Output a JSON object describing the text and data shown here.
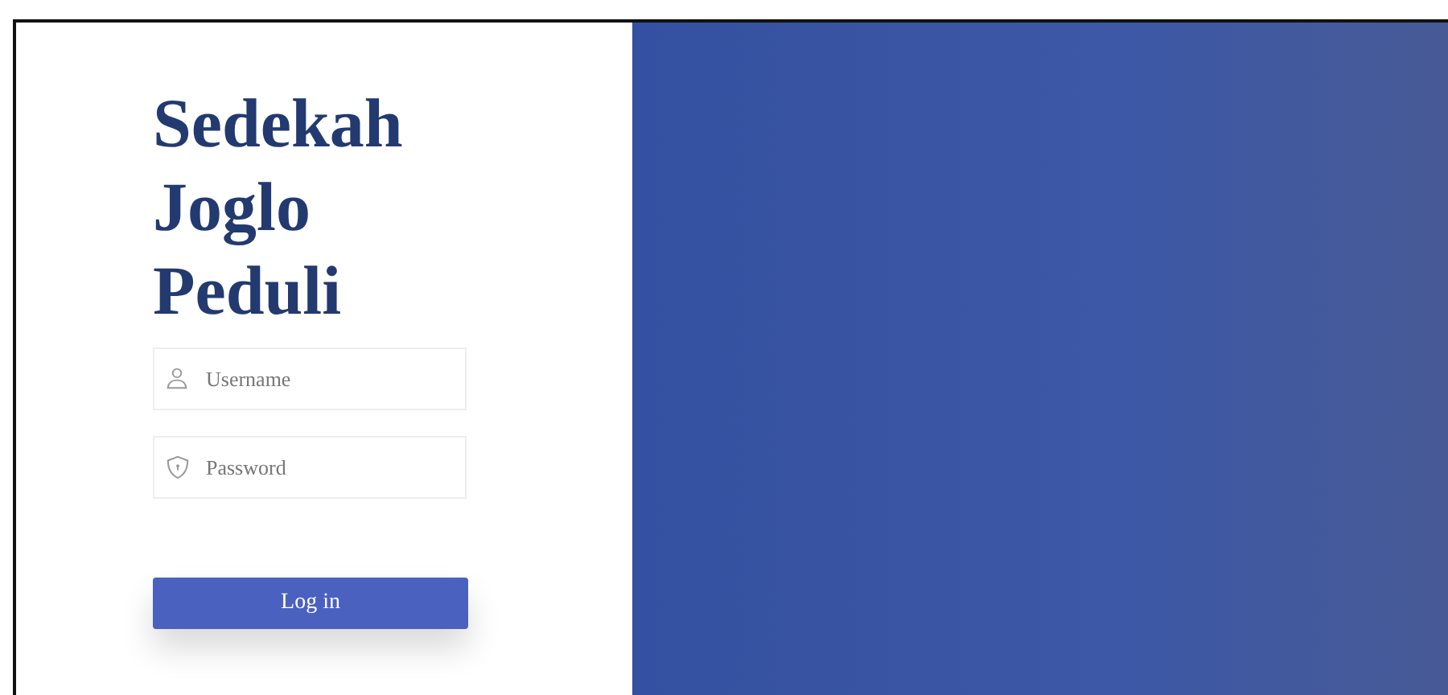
{
  "title": [
    "Sedekah",
    "Joglo",
    "Peduli"
  ],
  "fields": [
    {
      "kind": "user",
      "placeholder": "Username"
    },
    {
      "kind": "password",
      "placeholder": "Password"
    }
  ],
  "button": "Log in"
}
